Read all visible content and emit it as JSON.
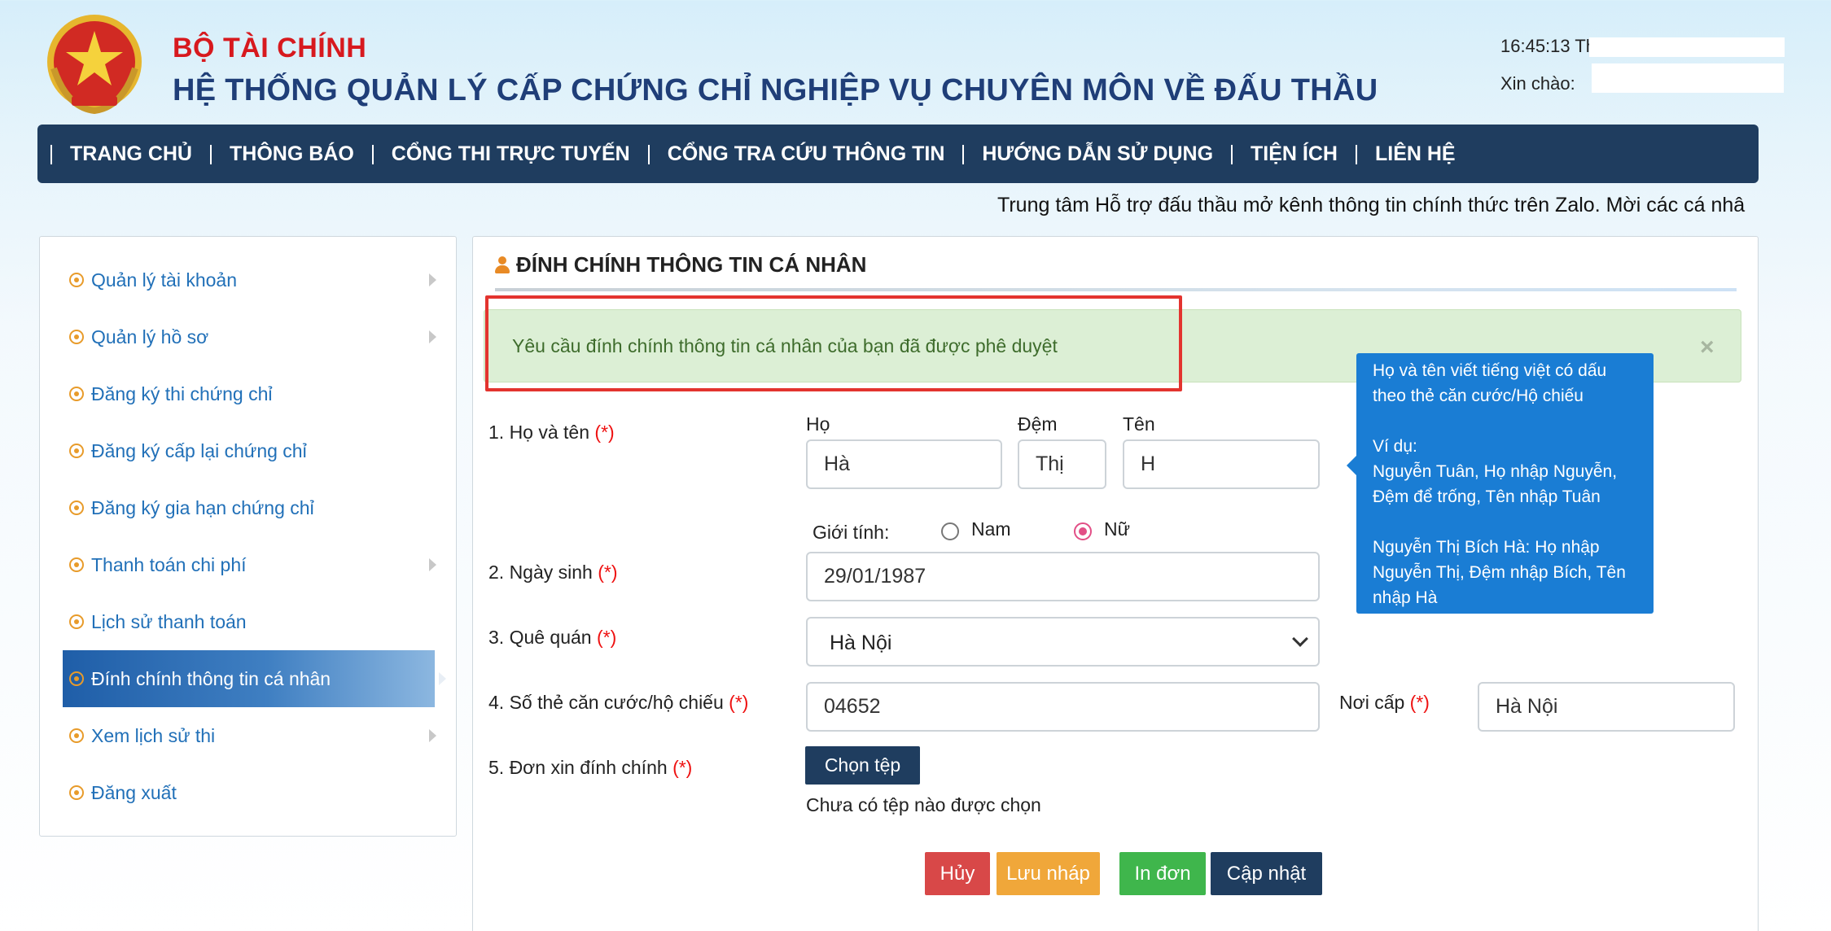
{
  "header": {
    "ministry": "BỘ TÀI CHÍNH",
    "system_title": "HỆ THỐNG QUẢN LÝ CẤP CHỨNG CHỈ NGHIỆP VỤ CHUYÊN MÔN VỀ ĐẤU THẦU",
    "clock": "16:45:13 Th",
    "greeting": "Xin chào:"
  },
  "nav": {
    "items": [
      "TRANG CHỦ",
      "THÔNG BÁO",
      "CỔNG THI TRỰC TUYẾN",
      "CỔNG TRA CỨU THÔNG TIN",
      "HƯỚNG DẪN SỬ DỤNG",
      "TIỆN ÍCH",
      "LIÊN HỆ"
    ]
  },
  "marquee": "Trung tâm Hỗ trợ đấu thầu mở kênh thông tin chính thức trên Zalo. Mời các cá nhâ",
  "sidebar": {
    "items": [
      {
        "label": "Quản lý tài khoản"
      },
      {
        "label": "Quản lý hồ sơ"
      },
      {
        "label": "Đăng ký thi chứng chỉ"
      },
      {
        "label": "Đăng ký cấp lại chứng chỉ"
      },
      {
        "label": "Đăng ký gia hạn chứng chỉ"
      },
      {
        "label": "Thanh toán chi phí"
      },
      {
        "label": "Lịch sử thanh toán"
      },
      {
        "label": "Đính chính thông tin cá nhân"
      },
      {
        "label": "Xem lịch sử thi"
      },
      {
        "label": "Đăng xuất"
      }
    ],
    "active": "Đính chính thông tin cá nhân"
  },
  "main": {
    "title": "ĐÍNH CHÍNH THÔNG TIN CÁ NHÂN",
    "alert": "Yêu cầu đính chính thông tin cá nhân của bạn đã được phê duyệt",
    "alert_close": "×",
    "required_mark": "(*)",
    "fields": {
      "name_label": "1. Họ và tên",
      "ho_label": "Họ",
      "dem_label": "Đệm",
      "ten_label": "Tên",
      "ho_value": "Hà",
      "dem_value": "Thị",
      "ten_value": "H",
      "gender_label": "Giới tính:",
      "gender_male": "Nam",
      "gender_female": "Nữ",
      "gender_selected": "Nữ",
      "dob_label": "2. Ngày sinh",
      "dob_value": "29/01/1987",
      "hometown_label": "3. Quê quán",
      "hometown_value": "Hà Nội",
      "id_label": "4. Số thẻ căn cước/hộ chiếu",
      "id_value": "04652",
      "issue_place_label": "Nơi cấp",
      "issue_place_value": "Hà Nội",
      "doc_label": "5. Đơn xin đính chính",
      "file_button": "Chọn tệp",
      "file_status": "Chưa có tệp nào được chọn"
    },
    "tooltip": "Họ và tên viết tiếng việt có dấu theo thẻ căn cước/Hộ chiếu\n\nVí dụ:\nNguyễn Tuân, Họ nhập Nguyễn, Đệm để trống, Tên nhập Tuân\n\nNguyễn Thị Bích Hà: Họ nhập Nguyễn Thị, Đệm nhập Bích, Tên nhập Hà",
    "buttons": {
      "cancel": "Hủy",
      "draft": "Lưu nháp",
      "print": "In đơn",
      "update": "Cập nhật"
    }
  },
  "colors": {
    "nav_bg": "#1f3d5f",
    "ministry_red": "#d7191e",
    "title_blue": "#1f3e78",
    "link_blue": "#2170b8",
    "alert_bg": "#dcefd5",
    "highlight_red": "#e3342f",
    "tooltip_bg": "#1a7dd4"
  }
}
